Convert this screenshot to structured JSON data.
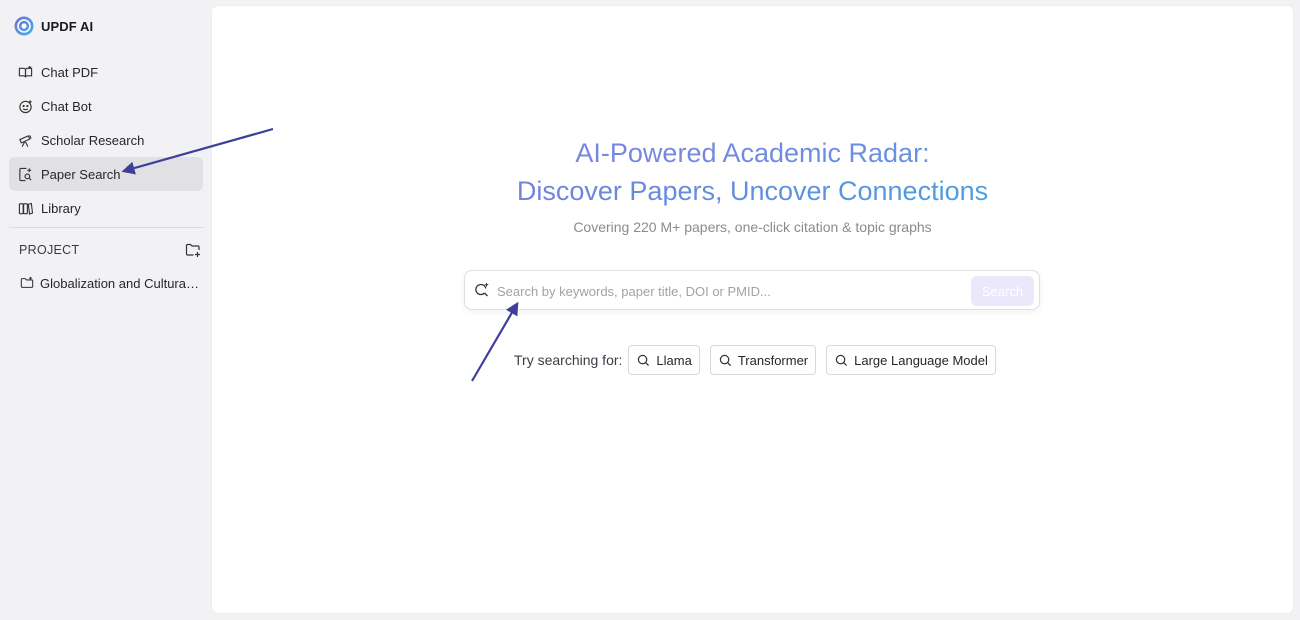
{
  "app": {
    "title": "UPDF AI"
  },
  "sidebar": {
    "items": [
      {
        "label": "Chat PDF",
        "icon": "book-icon"
      },
      {
        "label": "Chat Bot",
        "icon": "bot-icon"
      },
      {
        "label": "Scholar Research",
        "icon": "telescope-icon"
      },
      {
        "label": "Paper Search",
        "icon": "paper-search-icon",
        "active": true
      },
      {
        "label": "Library",
        "icon": "library-icon"
      }
    ],
    "project": {
      "header": "PROJECT",
      "items": [
        {
          "label": "Globalization and Cultural Identity"
        }
      ]
    }
  },
  "main": {
    "title_line1": "AI-Powered Academic Radar:",
    "title_line2": "Discover Papers, Uncover Connections",
    "subtitle": "Covering 220 M+ papers, one-click citation & topic graphs",
    "search": {
      "placeholder": "Search by keywords, paper title, DOI or PMID...",
      "value": "",
      "button_label": "Search"
    },
    "suggestions": {
      "label": "Try searching for:",
      "items": [
        "Llama",
        "Transformer",
        "Large Language Model"
      ]
    }
  },
  "colors": {
    "active_nav_bg": "#e1e1e5",
    "title_gradient_start": "#8a72d8",
    "title_gradient_end": "#34b4e0",
    "search_button_bg": "#ebe8fb",
    "annotation_arrow": "#3f3f9a"
  }
}
